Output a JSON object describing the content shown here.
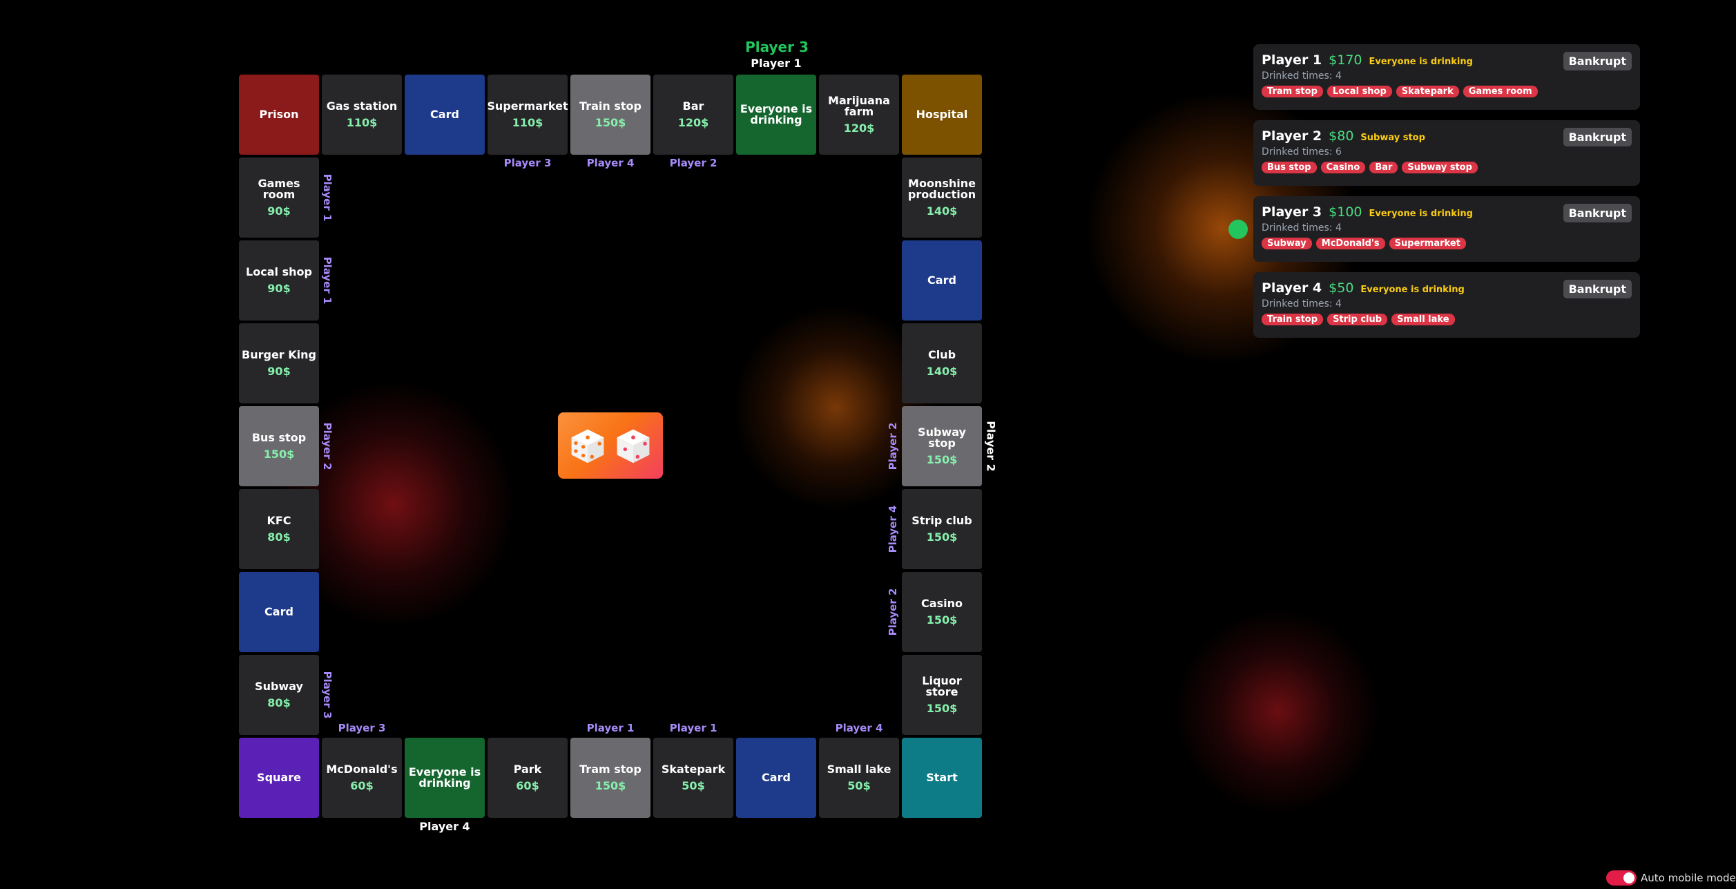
{
  "board": {
    "current_player": "Player 3",
    "tiles": {
      "prison": {
        "name": "Prison"
      },
      "gas_station": {
        "name": "Gas station",
        "price": "110$"
      },
      "card_top": {
        "name": "Card"
      },
      "supermarket": {
        "name": "Supermarket",
        "price": "110$"
      },
      "train_stop": {
        "name": "Train stop",
        "price": "150$"
      },
      "bar": {
        "name": "Bar",
        "price": "120$"
      },
      "drink_top": {
        "name": "Everyone is drinking"
      },
      "marijuana_farm": {
        "name": "Marijuana farm",
        "price": "120$"
      },
      "hospital": {
        "name": "Hospital"
      },
      "games_room": {
        "name": "Games room",
        "price": "90$"
      },
      "local_shop": {
        "name": "Local shop",
        "price": "90$"
      },
      "burger_king": {
        "name": "Burger King",
        "price": "90$"
      },
      "bus_stop": {
        "name": "Bus stop",
        "price": "150$"
      },
      "kfc": {
        "name": "KFC",
        "price": "80$"
      },
      "card_left": {
        "name": "Card"
      },
      "subway": {
        "name": "Subway",
        "price": "80$"
      },
      "moonshine": {
        "name": "Moonshine production",
        "price": "140$"
      },
      "card_right": {
        "name": "Card"
      },
      "club": {
        "name": "Club",
        "price": "140$"
      },
      "subway_stop": {
        "name": "Subway stop",
        "price": "150$"
      },
      "strip_club": {
        "name": "Strip club",
        "price": "150$"
      },
      "casino": {
        "name": "Casino",
        "price": "150$"
      },
      "liquor_store": {
        "name": "Liquor store",
        "price": "150$"
      },
      "square": {
        "name": "Square"
      },
      "mcdonalds": {
        "name": "McDonald's",
        "price": "60$"
      },
      "drink_bottom": {
        "name": "Everyone is drinking"
      },
      "park": {
        "name": "Park",
        "price": "60$"
      },
      "tram_stop": {
        "name": "Tram stop",
        "price": "150$"
      },
      "skatepark": {
        "name": "Skatepark",
        "price": "50$"
      },
      "card_bottom": {
        "name": "Card"
      },
      "small_lake": {
        "name": "Small lake",
        "price": "50$"
      },
      "start": {
        "name": "Start"
      }
    },
    "owners": {
      "supermarket": "Player 3",
      "train_stop": "Player 4",
      "bar": "Player 2",
      "games_room": "Player 1",
      "local_shop": "Player 1",
      "bus_stop": "Player 2",
      "subway": "Player 3",
      "subway_stop": "Player 2",
      "strip_club": "Player 4",
      "casino": "Player 2",
      "mcdonalds": "Player 3",
      "tram_stop": "Player 1",
      "skatepark": "Player 1",
      "small_lake": "Player 4"
    },
    "positions": {
      "drink_top": "Player 1",
      "subway_stop": "Player 2",
      "drink_bottom": "Player 4"
    }
  },
  "players": [
    {
      "name": "Player 1",
      "money": "$170",
      "status": "Everyone is drinking",
      "drinked": "Drinked times: 4",
      "properties": [
        "Tram stop",
        "Local shop",
        "Skatepark",
        "Games room"
      ],
      "bankrupt_label": "Bankrupt"
    },
    {
      "name": "Player 2",
      "money": "$80",
      "status": "Subway stop",
      "drinked": "Drinked times: 6",
      "properties": [
        "Bus stop",
        "Casino",
        "Bar",
        "Subway stop"
      ],
      "bankrupt_label": "Bankrupt"
    },
    {
      "name": "Player 3",
      "money": "$100",
      "status": "Everyone is drinking",
      "drinked": "Drinked times: 4",
      "properties": [
        "Subway",
        "McDonald's",
        "Supermarket"
      ],
      "bankrupt_label": "Bankrupt"
    },
    {
      "name": "Player 4",
      "money": "$50",
      "status": "Everyone is drinking",
      "drinked": "Drinked times: 4",
      "properties": [
        "Train stop",
        "Strip club",
        "Small lake"
      ],
      "bankrupt_label": "Bankrupt"
    }
  ],
  "settings": {
    "auto_mobile_label": "Auto mobile mode",
    "auto_mobile_on": true
  },
  "icons": {
    "dice": "dice-icon",
    "toggle": "toggle-icon"
  },
  "colors": {
    "money": "#4ade80",
    "status": "#facc15",
    "owner": "#a78bfa",
    "current_player": "#22c55e",
    "chip": "#dc3545"
  }
}
